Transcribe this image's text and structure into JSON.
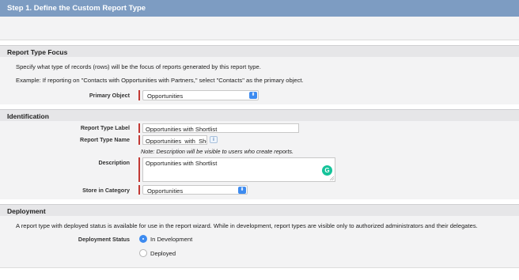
{
  "header": {
    "title": "Step 1. Define the Custom Report Type"
  },
  "focus": {
    "heading": "Report Type Focus",
    "desc1": "Specify what type of records (rows) will be the focus of reports generated by this report type.",
    "desc2": "Example: If reporting on \"Contacts with Opportunities with Partners,\" select \"Contacts\" as the primary object.",
    "primary_object_label": "Primary Object",
    "primary_object_value": "Opportunities"
  },
  "identification": {
    "heading": "Identification",
    "report_type_label_label": "Report Type Label",
    "report_type_label_value": "Opportunities with Shortlist",
    "report_type_name_label": "Report Type Name",
    "report_type_name_value": "Opportunities_with_Shor",
    "info_glyph": "i",
    "note": "Note: Description will be visible to users who create reports.",
    "description_label": "Description",
    "description_value": "Opportunities with Shortlist",
    "grammarly_glyph": "G",
    "category_label": "Store in Category",
    "category_value": "Opportunities"
  },
  "deployment": {
    "heading": "Deployment",
    "desc": "A report type with deployed status is available for use in the report wizard. While in development, report types are visible only to authorized administrators and their delegates.",
    "status_label": "Deployment Status",
    "options": [
      "In Development",
      "Deployed"
    ],
    "selected": "In Development"
  },
  "icons": {
    "select_chevron": "chevron-updown-icon",
    "chevron_glyph": "⬍"
  },
  "colors": {
    "header": "#7d9cc2",
    "required": "#c23934",
    "accent": "#3d8bf0",
    "grammarly": "#15c39a"
  }
}
